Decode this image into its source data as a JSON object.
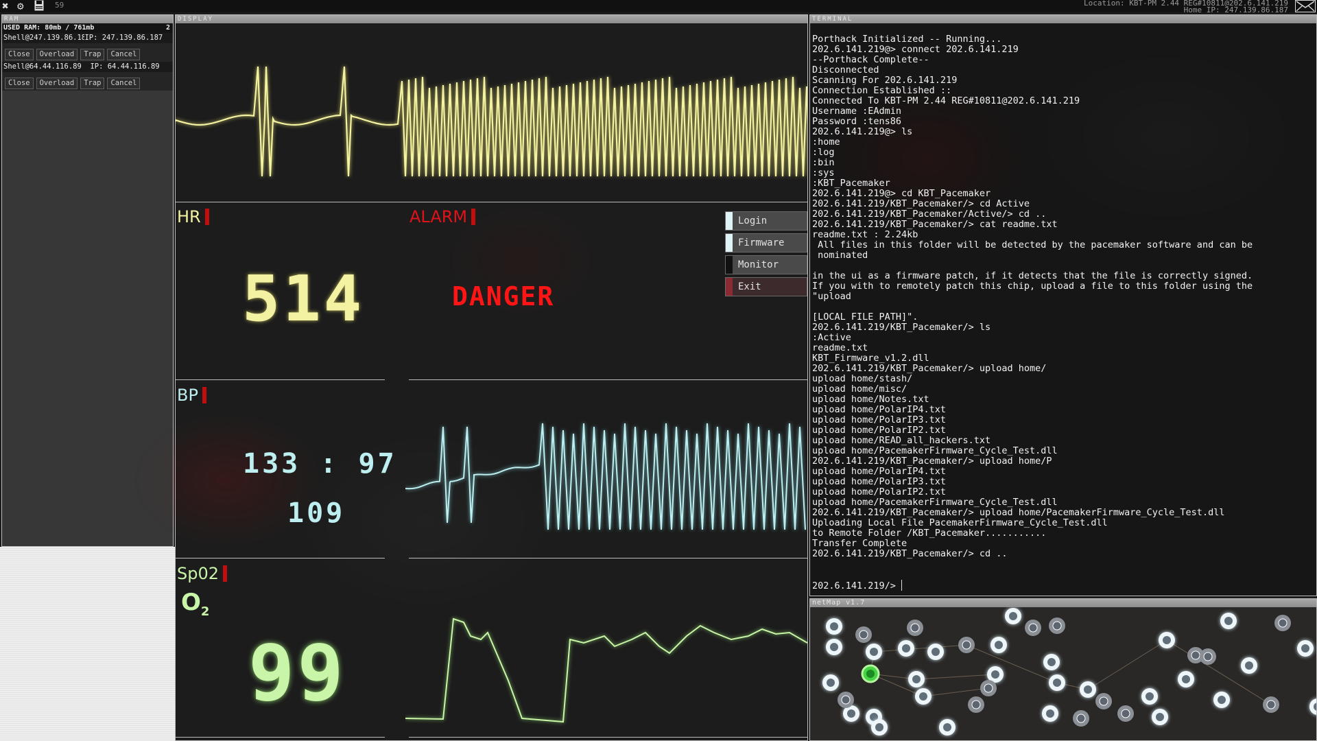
{
  "topbar": {
    "icons": [
      "close-icon",
      "gear-icon",
      "save-icon"
    ],
    "fps": "59",
    "location_label": "Location: KBT-PM 2.44 REG#10811@202.6.141.219",
    "home_ip_label": "Home IP: 247.139.86.187",
    "mail_icon": "mail-icon"
  },
  "ram": {
    "title": "RAM",
    "used_label": "USED RAM: 80mb / 761mb",
    "process_count": "2",
    "shells": [
      {
        "shell": "Shell@247.139.86.187",
        "ip": "IP: 247.139.86.187",
        "buttons": [
          "Close",
          "Overload",
          "Trap",
          "Cancel"
        ]
      },
      {
        "shell": "Shell@64.44.116.89",
        "ip": "IP: 64.44.116.89",
        "buttons": [
          "Close",
          "Overload",
          "Trap",
          "Cancel"
        ]
      }
    ]
  },
  "display": {
    "title": "DISPLAY",
    "hr": {
      "label": "HR",
      "value": "514"
    },
    "alarm": {
      "label": "ALARM",
      "status": "DANGER"
    },
    "bp": {
      "label": "BP",
      "value": "133 : 97",
      "mean": "109"
    },
    "spo2": {
      "label": "Sp02",
      "symbol": "O",
      "subscript": "2",
      "value": "99"
    },
    "menu": [
      {
        "label": "Login",
        "swatch": "#dff3f6"
      },
      {
        "label": "Firmware",
        "swatch": "#dff3f6"
      },
      {
        "label": "Monitor",
        "swatch": "#111111"
      },
      {
        "label": "Exit",
        "swatch": "#8a2a32"
      }
    ],
    "colors": {
      "hr": "#f3f1a2",
      "alarm": "#e0121a",
      "bp": "#bdeef0",
      "spo2": "#c8f5a8"
    }
  },
  "terminal": {
    "title": "TERMINAL",
    "lines": [
      "Porthack Initialized -- Running...",
      "202.6.141.219@> connect 202.6.141.219",
      "--Porthack Complete--",
      "Disconnected",
      "Scanning For 202.6.141.219",
      "Connection Established ::",
      "Connected To KBT-PM 2.44 REG#10811@202.6.141.219",
      "Username :EAdmin",
      "Password :tens86",
      "202.6.141.219@> ls",
      ":home",
      ":log",
      ":bin",
      ":sys",
      ":KBT_Pacemaker",
      "202.6.141.219@> cd KBT_Pacemaker",
      "202.6.141.219/KBT_Pacemaker/> cd Active",
      "202.6.141.219/KBT_Pacemaker/Active/> cd ..",
      "202.6.141.219/KBT_Pacemaker/> cat readme.txt",
      "readme.txt : 2.24kb",
      " All files in this folder will be detected by the pacemaker software and can be",
      " nominated",
      "",
      "in the ui as a firmware patch, if it detects that the file is correctly signed.",
      "If you with to remotely patch this chip, upload a file to this folder using the",
      "\"upload",
      "",
      "[LOCAL FILE PATH]\".",
      "202.6.141.219/KBT_Pacemaker/> ls",
      ":Active",
      "readme.txt",
      "KBT_Firmware_v1.2.dll",
      "202.6.141.219/KBT_Pacemaker/> upload home/",
      "upload home/stash/",
      "upload home/misc/",
      "upload home/Notes.txt",
      "upload home/PolarIP4.txt",
      "upload home/PolarIP3.txt",
      "upload home/PolarIP2.txt",
      "upload home/READ_all_hackers.txt",
      "upload home/PacemakerFirmware_Cycle_Test.dll",
      "202.6.141.219/KBT_Pacemaker/> upload home/P",
      "upload home/PolarIP4.txt",
      "upload home/PolarIP3.txt",
      "upload home/PolarIP2.txt",
      "upload home/PacemakerFirmware_Cycle_Test.dll",
      "202.6.141.219/KBT_Pacemaker/> upload home/PacemakerFirmware_Cycle_Test.dll",
      "Uploading Local File PacemakerFirmware_Cycle_Test.dll",
      "to Remote Folder /KBT_Pacemaker...........",
      "Transfer Complete",
      "202.6.141.219/KBT_Pacemaker/> cd .."
    ],
    "prompt": "202.6.141.219/>"
  },
  "netmap": {
    "title": "netMap v1.7",
    "nodes": [
      {
        "id": 0,
        "state": "home"
      },
      {
        "id": 1,
        "state": "discovered"
      },
      {
        "id": 2,
        "state": "discovered"
      },
      {
        "id": 3,
        "state": "owned"
      },
      {
        "id": 4,
        "state": "discovered"
      },
      {
        "id": 5,
        "state": "discovered"
      },
      {
        "id": 6,
        "state": "owned"
      },
      {
        "id": 7,
        "state": "discovered"
      },
      {
        "id": 8,
        "state": "discovered"
      },
      {
        "id": 9,
        "state": "discovered"
      },
      {
        "id": 10,
        "state": "discovered"
      },
      {
        "id": 11,
        "state": "owned"
      },
      {
        "id": 12,
        "state": "discovered"
      },
      {
        "id": 13,
        "state": "discovered"
      },
      {
        "id": 14,
        "state": "discovered"
      },
      {
        "id": 15,
        "state": "discovered"
      },
      {
        "id": 16,
        "state": "owned"
      },
      {
        "id": 17,
        "state": "discovered"
      },
      {
        "id": 18,
        "state": "discovered"
      },
      {
        "id": 19,
        "state": "owned"
      },
      {
        "id": 20,
        "state": "owned"
      },
      {
        "id": 21,
        "state": "discovered"
      },
      {
        "id": 22,
        "state": "owned"
      },
      {
        "id": 23,
        "state": "owned"
      },
      {
        "id": 24,
        "state": "discovered"
      },
      {
        "id": 25,
        "state": "discovered"
      },
      {
        "id": 26,
        "state": "discovered"
      },
      {
        "id": 27,
        "state": "owned"
      },
      {
        "id": 28,
        "state": "discovered"
      },
      {
        "id": 29,
        "state": "owned"
      },
      {
        "id": 30,
        "state": "owned"
      },
      {
        "id": 31,
        "state": "discovered"
      },
      {
        "id": 32,
        "state": "discovered"
      },
      {
        "id": 33,
        "state": "discovered"
      },
      {
        "id": 34,
        "state": "discovered"
      },
      {
        "id": 35,
        "state": "owned"
      },
      {
        "id": 36,
        "state": "discovered"
      },
      {
        "id": 37,
        "state": "discovered"
      },
      {
        "id": 38,
        "state": "owned"
      },
      {
        "id": 39,
        "state": "owned"
      },
      {
        "id": 40,
        "state": "discovered"
      },
      {
        "id": 41,
        "state": "discovered"
      },
      {
        "id": 42,
        "state": "owned"
      },
      {
        "id": 43,
        "state": "discovered"
      }
    ]
  }
}
